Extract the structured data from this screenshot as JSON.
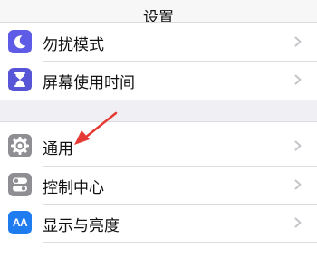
{
  "nav": {
    "title": "设置"
  },
  "group1": {
    "items": [
      {
        "label": "勿扰模式",
        "icon": "moon-icon",
        "color": "#5e5ce6"
      },
      {
        "label": "屏幕使用时间",
        "icon": "hourglass-icon",
        "color": "#5856d6"
      }
    ]
  },
  "group2": {
    "items": [
      {
        "label": "通用",
        "icon": "gear-icon",
        "color": "#8e8e93"
      },
      {
        "label": "控制中心",
        "icon": "toggles-icon",
        "color": "#8e8e93"
      },
      {
        "label": "显示与亮度",
        "icon": "text-size-icon",
        "color": "#1e7cf0",
        "icon_text": "AA"
      }
    ]
  },
  "annotation": {
    "color": "#e53935"
  }
}
